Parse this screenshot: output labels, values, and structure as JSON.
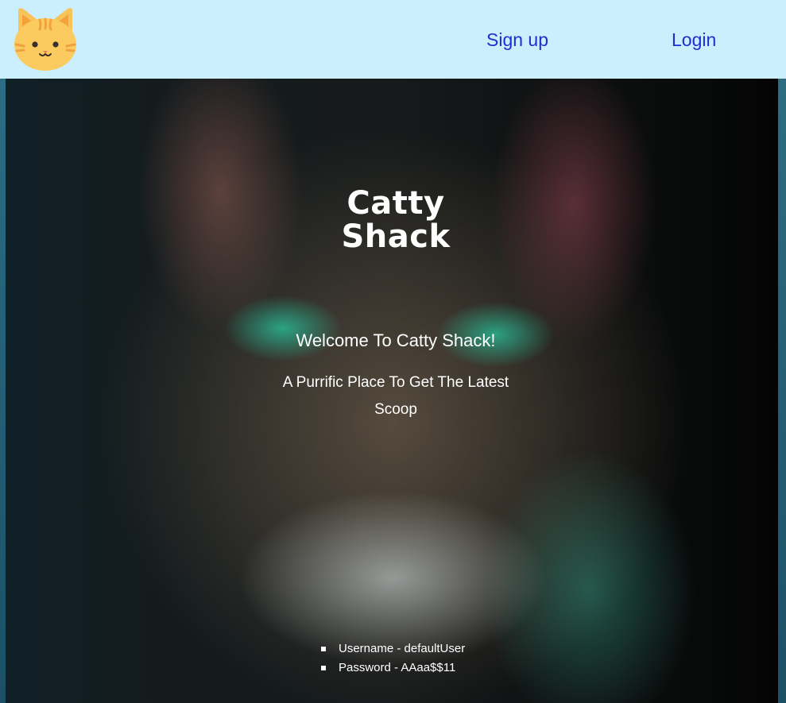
{
  "nav": {
    "logo_icon": "cat-face-icon",
    "signup_label": "Sign up",
    "login_label": "Login",
    "link_color": "#1c2fd1",
    "background_color": "#cbeffd"
  },
  "hero": {
    "background": "blurred-cat-photo",
    "brand_line1": "Catty",
    "brand_line2": "Shack",
    "welcome": "Welcome To Catty Shack!",
    "tagline": "A Purrific Place To Get The Latest Scoop",
    "demo_credentials": [
      {
        "text": "Username - defaultUser"
      },
      {
        "text": "Password - AAaa$$11"
      }
    ]
  }
}
